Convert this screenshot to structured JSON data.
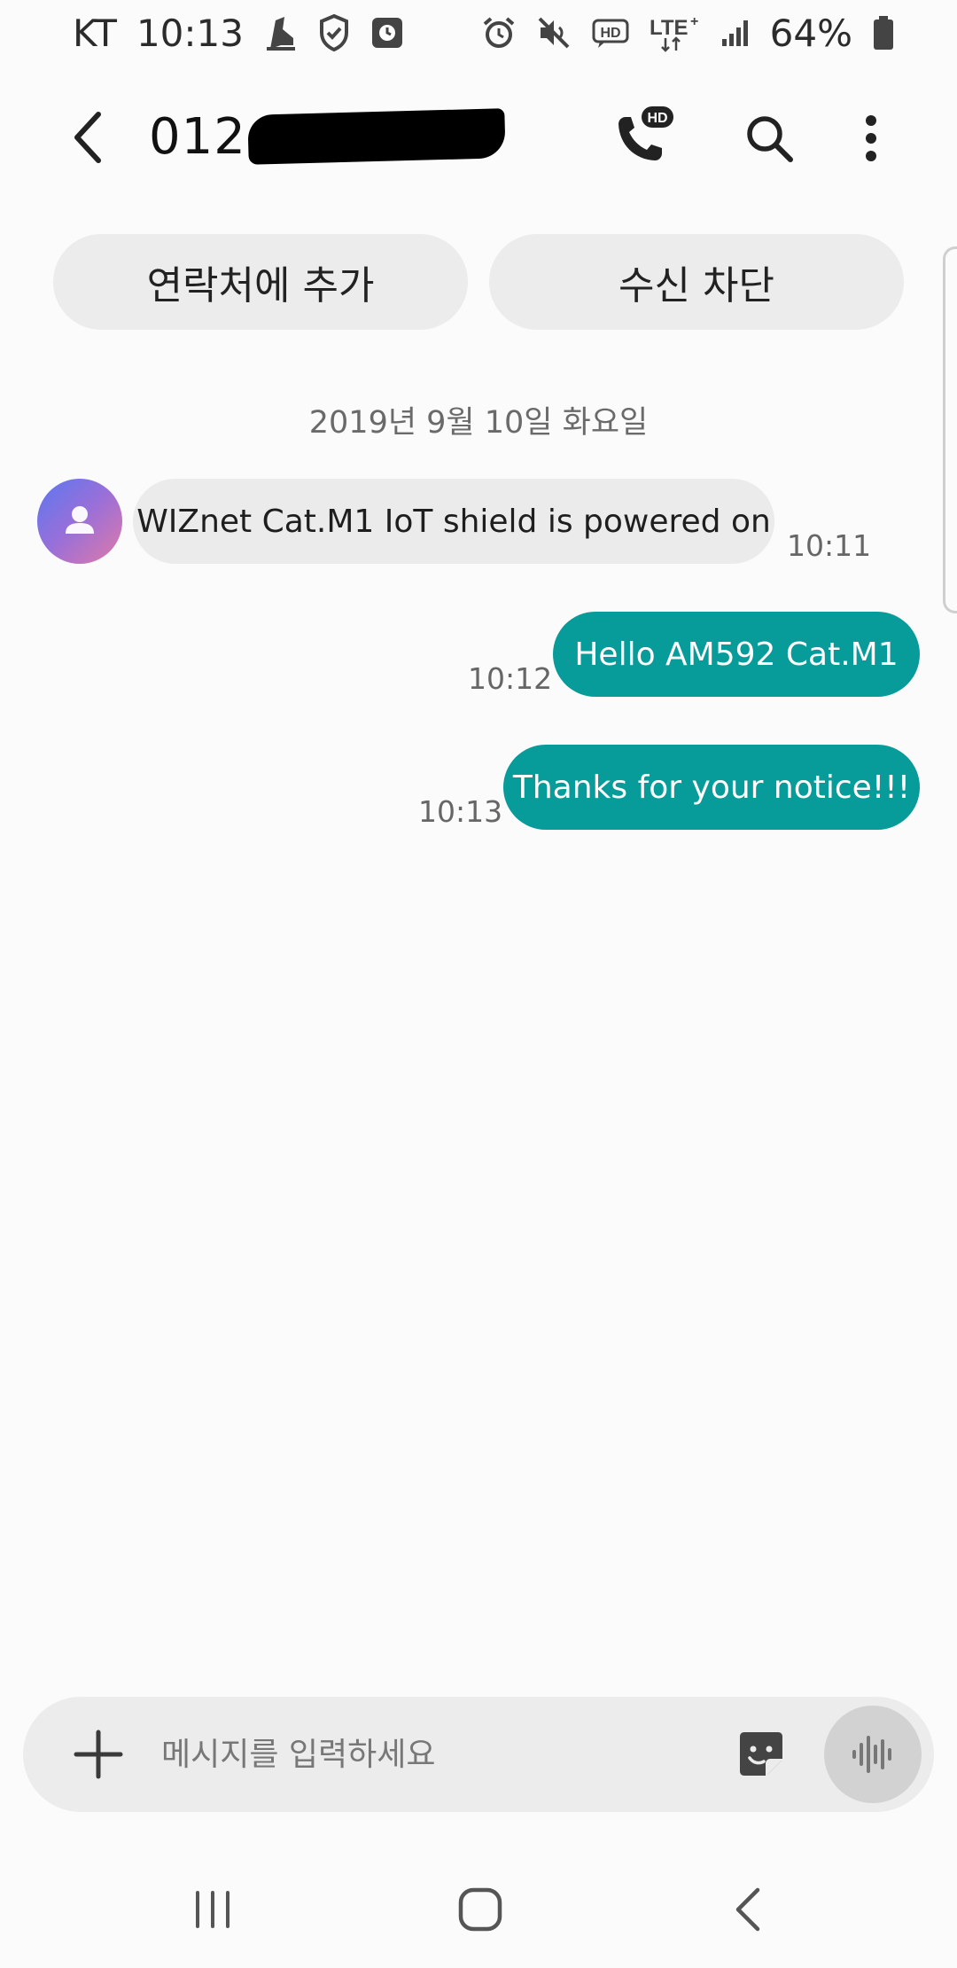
{
  "status_bar": {
    "carrier": "KT",
    "time": "10:13",
    "left_icons": [
      "shoe-icon",
      "shield-icon",
      "clock-app-icon"
    ],
    "right_icons": [
      "alarm-icon",
      "mute-icon",
      "hd-voice-icon",
      "lte-icon",
      "signal-icon"
    ],
    "battery": "64%"
  },
  "header": {
    "contact_number": "012-",
    "redacted": true,
    "icons": [
      "back-arrow-icon",
      "hd-call-icon",
      "search-icon",
      "more-vertical-icon"
    ]
  },
  "actions": {
    "add_contact": "연락처에 추가",
    "block": "수신 차단"
  },
  "conversation": {
    "date": "2019년 9월 10일 화요일",
    "messages": [
      {
        "direction": "incoming",
        "text": "WIZnet Cat.M1 IoT shield is powered on",
        "time": "10:11"
      },
      {
        "direction": "outgoing",
        "text": "Hello AM592 Cat.M1",
        "time": "10:12"
      },
      {
        "direction": "outgoing",
        "text": "Thanks for your notice!!!",
        "time": "10:13"
      }
    ]
  },
  "composer": {
    "placeholder": "메시지를 입력하세요",
    "value": ""
  },
  "colors": {
    "outgoing_bubble": "#079b99",
    "incoming_bubble": "#ebebeb",
    "background": "#fbfbfb"
  }
}
